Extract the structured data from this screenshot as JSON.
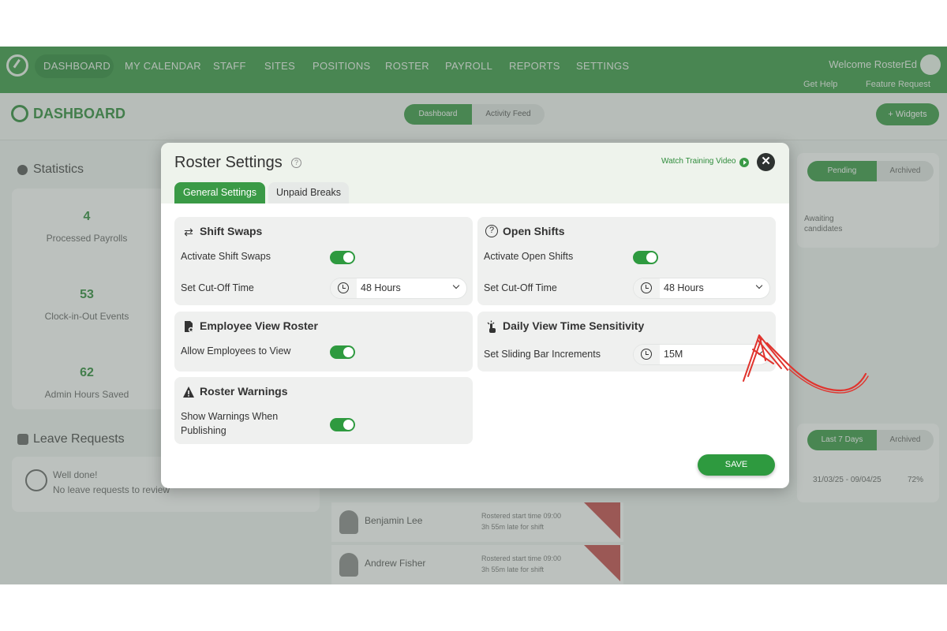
{
  "nav": {
    "items": [
      "DASHBOARD",
      "MY CALENDAR",
      "STAFF",
      "SITES",
      "POSITIONS",
      "ROSTER",
      "PAYROLL",
      "REPORTS",
      "SETTINGS"
    ],
    "welcome": "Welcome RosterEd",
    "get_help": "Get Help",
    "feature_request": "Feature Request"
  },
  "dashboard": {
    "title": "DASHBOARD",
    "seg_dashboard": "Dashboard",
    "seg_activity": "Activity Feed",
    "widgets_button": "+ Widgets",
    "statistics_title": "Statistics",
    "stats": [
      {
        "value": "4",
        "label": "Processed Payrolls"
      },
      {
        "value": "53",
        "label": "Clock-in-Out Events"
      },
      {
        "value": "62",
        "label": "Admin Hours Saved"
      }
    ],
    "leave_title": "Leave Requests",
    "well_done": "Well done!",
    "no_leave": "No leave requests to review",
    "pending_tab": "Pending",
    "archived_tab": "Archived",
    "awaiting": "Awaiting candidates",
    "leave_days_tab": "Last 7 Days",
    "leave_dates": "31/03/25 - 09/04/25",
    "leave_pct": "72%",
    "staff_rows": [
      {
        "name": "Benjamin Lee",
        "note1": "Rostered start time 09:00",
        "note2": "3h 55m late for shift"
      },
      {
        "name": "Andrew Fisher",
        "note1": "Rostered start time 09:00",
        "note2": "3h 55m late for shift"
      }
    ]
  },
  "modal": {
    "title": "Roster Settings",
    "help_icon": "?",
    "watch_video": "Watch Training Video",
    "tabs": {
      "general": "General Settings",
      "unpaid": "Unpaid Breaks"
    },
    "shift_swaps": {
      "title": "Shift Swaps",
      "activate_label": "Activate Shift Swaps",
      "activate_on": true,
      "cutoff_label": "Set Cut-Off Time",
      "cutoff_value": "48 Hours"
    },
    "open_shifts": {
      "title": "Open Shifts",
      "activate_label": "Activate Open Shifts",
      "activate_on": true,
      "cutoff_label": "Set Cut-Off Time",
      "cutoff_value": "48 Hours"
    },
    "employee_view": {
      "title": "Employee View Roster",
      "allow_label": "Allow Employees to View",
      "allow_on": true
    },
    "daily_view": {
      "title": "Daily View Time Sensitivity",
      "increments_label": "Set Sliding Bar Increments",
      "increments_value": "15M"
    },
    "roster_warnings": {
      "title": "Roster Warnings",
      "show_label_line1": "Show Warnings When",
      "show_label_line2": "Publishing",
      "show_on": true
    },
    "save_label": "SAVE"
  },
  "colors": {
    "accent": "#2e9a3f",
    "annotation": "#e0342e"
  }
}
